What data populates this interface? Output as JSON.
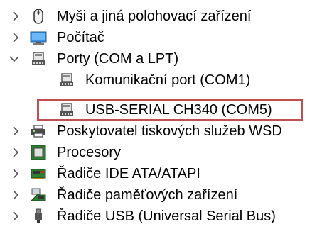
{
  "tree": {
    "items": [
      {
        "label": "Myši a jiná polohovací zařízení",
        "icon": "mouse-icon",
        "expanded": false
      },
      {
        "label": "Počítač",
        "icon": "computer-icon",
        "expanded": false
      },
      {
        "label": "Porty (COM a LPT)",
        "icon": "port-icon",
        "expanded": true
      },
      {
        "label": "Komunikační port (COM1)",
        "icon": "port-icon"
      },
      {
        "label": "USB-SERIAL CH340 (COM5)",
        "icon": "port-icon",
        "highlighted": true
      },
      {
        "label": "Poskytovatel tiskových služeb WSD",
        "icon": "printer-icon",
        "expanded": false
      },
      {
        "label": "Procesory",
        "icon": "processor-icon",
        "expanded": false
      },
      {
        "label": "Řadiče IDE ATA/ATAPI",
        "icon": "ide-controller-icon",
        "expanded": false
      },
      {
        "label": "Řadiče paměťových zařízení",
        "icon": "storage-controller-icon",
        "expanded": false
      },
      {
        "label": "Řadiče USB (Universal Serial Bus)",
        "icon": "usb-icon",
        "expanded": false
      }
    ]
  },
  "colors": {
    "highlight_border": "#c0504d",
    "chevron": "#555555"
  }
}
